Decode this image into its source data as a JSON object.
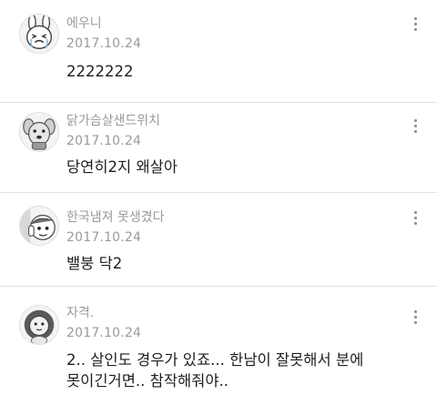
{
  "comments": [
    {
      "author": "에우니",
      "date": "2017.10.24",
      "lines": [
        "2222222"
      ],
      "avatar_icon": "crying-rabbit-icon"
    },
    {
      "author": "닭가슴살샌드위치",
      "date": "2017.10.24",
      "lines": [
        "당연히2지 왜살아"
      ],
      "avatar_icon": "dog-character-icon"
    },
    {
      "author": "한국냄져 못생겼다",
      "date": "2017.10.24",
      "lines": [
        "밸붕 닥2"
      ],
      "avatar_icon": "peeking-character-icon"
    },
    {
      "author": "자격.",
      "date": "2017.10.24",
      "lines": [
        "2.. 살인도 경우가 있죠... 한남이 잘못해서 분에",
        "못이긴거면.. 참작해줘야.."
      ],
      "avatar_icon": "lion-character-icon"
    }
  ],
  "icons": {
    "more": "more-vertical-icon"
  },
  "colors": {
    "meta_text": "#9a9a9a",
    "body_text": "#1e1e1e",
    "divider": "#e1e1e1"
  }
}
